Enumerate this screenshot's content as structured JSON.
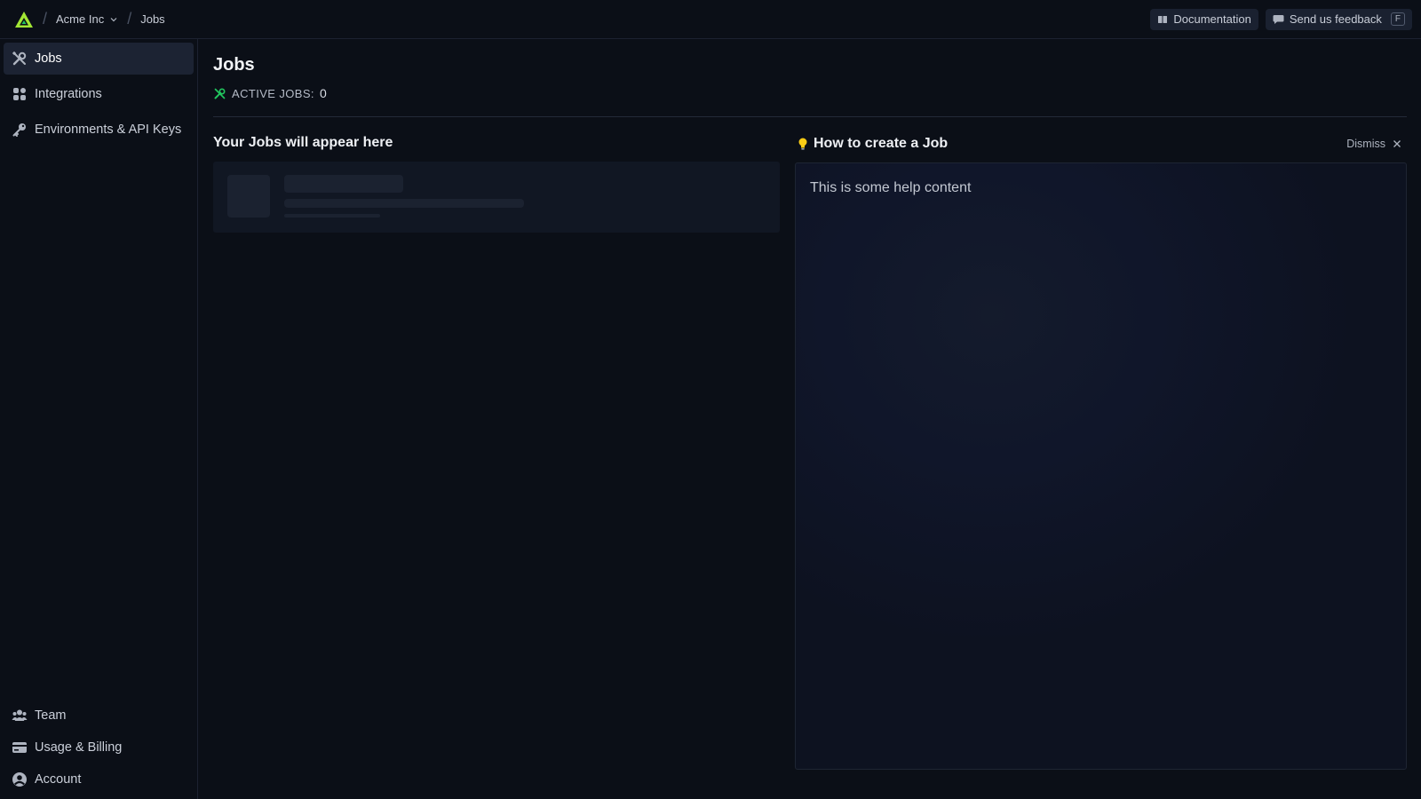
{
  "breadcrumb": {
    "org": "Acme Inc",
    "page": "Jobs"
  },
  "topbar": {
    "documentation_label": "Documentation",
    "feedback_label": "Send us feedback",
    "feedback_shortcut": "F"
  },
  "sidebar": {
    "items": [
      {
        "label": "Jobs",
        "icon": "wrench-screwdriver-icon",
        "active": true
      },
      {
        "label": "Integrations",
        "icon": "grid-icon",
        "active": false
      },
      {
        "label": "Environments & API Keys",
        "icon": "key-icon",
        "active": false
      }
    ],
    "bottom_items": [
      {
        "label": "Team",
        "icon": "users-icon"
      },
      {
        "label": "Usage & Billing",
        "icon": "credit-card-icon"
      },
      {
        "label": "Account",
        "icon": "user-circle-icon"
      }
    ]
  },
  "main": {
    "title": "Jobs",
    "active_jobs_label": "ACTIVE JOBS:",
    "active_jobs_count": "0",
    "jobs_section_title": "Your Jobs will appear here",
    "help_title": "How to create a Job",
    "dismiss_label": "Dismiss",
    "help_content": "This is some help content"
  },
  "colors": {
    "background": "#0b0f17",
    "accent_green": "#22c55e",
    "logo_green": "#a3e635",
    "bulb_yellow": "#facc15"
  }
}
